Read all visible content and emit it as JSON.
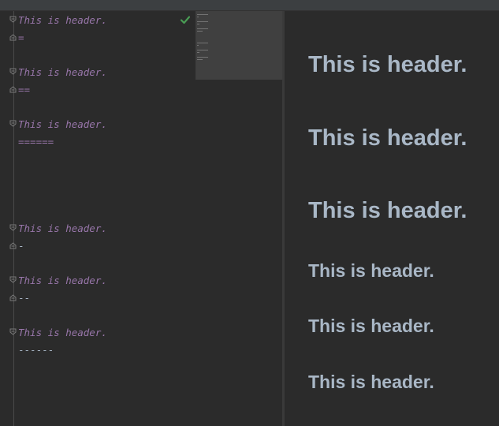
{
  "editor": {
    "lines": [
      {
        "header": "This is header.",
        "underline": "="
      },
      {
        "header": "This is header.",
        "underline": "=="
      },
      {
        "header": "This is header.",
        "underline": "======"
      },
      {
        "header": "This is header.",
        "underline": "-"
      },
      {
        "header": "This is header.",
        "underline": "--"
      },
      {
        "header": "This is header.",
        "underline": "------"
      }
    ],
    "status_icon": "checkmark-icon",
    "status_color": "#499c54"
  },
  "preview": {
    "headers": [
      {
        "text": "This is header.",
        "level": "h1"
      },
      {
        "text": "This is header.",
        "level": "h1"
      },
      {
        "text": "This is header.",
        "level": "h1"
      },
      {
        "text": "This is header.",
        "level": "h2"
      },
      {
        "text": "This is header.",
        "level": "h2"
      },
      {
        "text": "This is header.",
        "level": "h2"
      }
    ]
  },
  "colors": {
    "background": "#2b2b2b",
    "header_markup": "#9876aa",
    "preview_text": "#a9b7c6"
  }
}
